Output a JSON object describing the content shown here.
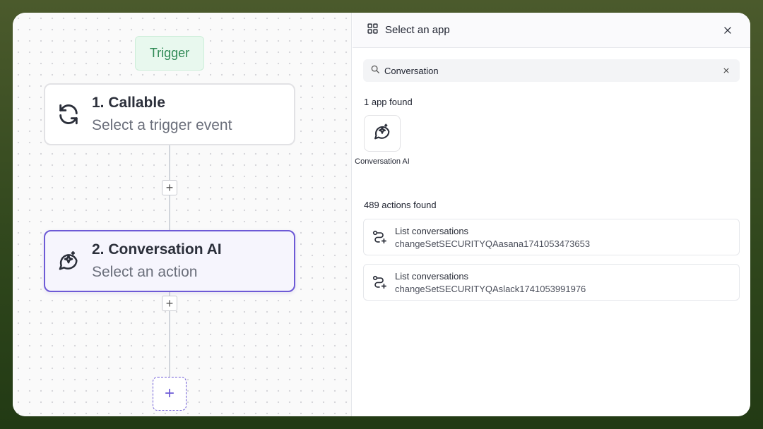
{
  "canvas": {
    "trigger_label": "Trigger",
    "steps": [
      {
        "title": "1. Callable",
        "subtitle": "Select a trigger event",
        "icon": "refresh-icon"
      },
      {
        "title": "2. Conversation AI",
        "subtitle": "Select an action",
        "icon": "sparkle-chat-icon"
      }
    ],
    "add_symbol": "+"
  },
  "panel": {
    "title": "Select an app",
    "search": {
      "value": "Conversation",
      "placeholder": ""
    },
    "apps_found_label": "1 app found",
    "apps": [
      {
        "name": "Conversation AI",
        "icon": "sparkle-chat-icon"
      }
    ],
    "actions_found_label": "489 actions found",
    "actions": [
      {
        "title": "List conversations",
        "subtitle": "changeSetSECURITYQAasana1741053473653",
        "icon": "route-plus-icon"
      },
      {
        "title": "List conversations",
        "subtitle": "changeSetSECURITYQAslack1741053991976",
        "icon": "route-plus-icon"
      }
    ]
  },
  "colors": {
    "accent": "#6d5ad6",
    "trigger_green": "#2f8a55",
    "trigger_bg": "#e8f8ee"
  }
}
